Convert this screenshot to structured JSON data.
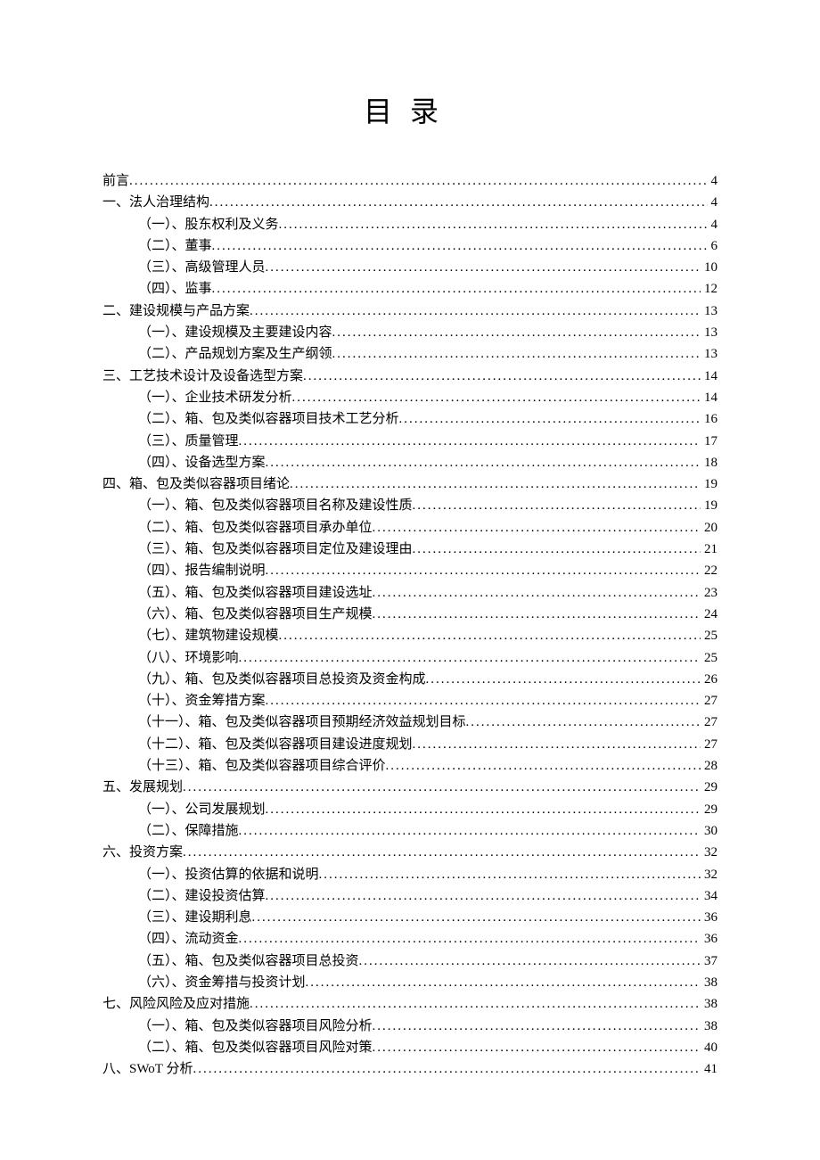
{
  "title": "目录",
  "toc": [
    {
      "label": "前言",
      "page": "4",
      "level": 0
    },
    {
      "label": "一、法人治理结构",
      "page": "4",
      "level": 0
    },
    {
      "label": "（一）、股东权利及义务",
      "page": "4",
      "level": 1
    },
    {
      "label": "（二）、董事",
      "page": "6",
      "level": 1
    },
    {
      "label": "（三）、高级管理人员",
      "page": "10",
      "level": 1
    },
    {
      "label": "（四）、监事",
      "page": "12",
      "level": 1
    },
    {
      "label": "二、建设规模与产品方案",
      "page": "13",
      "level": 0
    },
    {
      "label": "（一）、建设规模及主要建设内容",
      "page": "13",
      "level": 1
    },
    {
      "label": "（二）、产品规划方案及生产纲领",
      "page": "13",
      "level": 1
    },
    {
      "label": "三、工艺技术设计及设备选型方案",
      "page": "14",
      "level": 0
    },
    {
      "label": "（一）、企业技术研发分析",
      "page": "14",
      "level": 1
    },
    {
      "label": "（二）、箱、包及类似容器项目技术工艺分析",
      "page": "16",
      "level": 1
    },
    {
      "label": "（三）、质量管理",
      "page": "17",
      "level": 1
    },
    {
      "label": "（四）、设备选型方案",
      "page": "18",
      "level": 1
    },
    {
      "label": "四、箱、包及类似容器项目绪论",
      "page": "19",
      "level": 0
    },
    {
      "label": "（一）、箱、包及类似容器项目名称及建设性质",
      "page": "19",
      "level": 1
    },
    {
      "label": "（二）、箱、包及类似容器项目承办单位",
      "page": "20",
      "level": 1
    },
    {
      "label": "（三）、箱、包及类似容器项目定位及建设理由",
      "page": "21",
      "level": 1
    },
    {
      "label": "（四）、报告编制说明",
      "page": "22",
      "level": 1
    },
    {
      "label": "（五）、箱、包及类似容器项目建设选址",
      "page": "23",
      "level": 1
    },
    {
      "label": "（六）、箱、包及类似容器项目生产规模",
      "page": "24",
      "level": 1
    },
    {
      "label": "（七）、建筑物建设规模",
      "page": "25",
      "level": 1
    },
    {
      "label": "（八）、环境影响",
      "page": "25",
      "level": 1
    },
    {
      "label": "（九）、箱、包及类似容器项目总投资及资金构成",
      "page": "26",
      "level": 1
    },
    {
      "label": "（十）、资金筹措方案",
      "page": "27",
      "level": 1
    },
    {
      "label": "（十一）、箱、包及类似容器项目预期经济效益规划目标",
      "page": "27",
      "level": 1
    },
    {
      "label": "（十二）、箱、包及类似容器项目建设进度规划",
      "page": "27",
      "level": 1
    },
    {
      "label": "（十三）、箱、包及类似容器项目综合评价",
      "page": "28",
      "level": 1
    },
    {
      "label": "五、发展规划",
      "page": "29",
      "level": 0
    },
    {
      "label": "（一）、公司发展规划",
      "page": "29",
      "level": 1
    },
    {
      "label": "（二）、保障措施",
      "page": "30",
      "level": 1
    },
    {
      "label": "六、投资方案",
      "page": "32",
      "level": 0
    },
    {
      "label": "（一）、投资估算的依据和说明",
      "page": "32",
      "level": 1
    },
    {
      "label": "（二）、建设投资估算",
      "page": "34",
      "level": 1
    },
    {
      "label": "（三）、建设期利息",
      "page": "36",
      "level": 1
    },
    {
      "label": "（四）、流动资金",
      "page": "36",
      "level": 1
    },
    {
      "label": "（五）、箱、包及类似容器项目总投资",
      "page": "37",
      "level": 1
    },
    {
      "label": "（六）、资金筹措与投资计划",
      "page": "38",
      "level": 1
    },
    {
      "label": "七、风险风险及应对措施",
      "page": "38",
      "level": 0
    },
    {
      "label": "（一）、箱、包及类似容器项目风险分析",
      "page": "38",
      "level": 1
    },
    {
      "label": "（二）、箱、包及类似容器项目风险对策",
      "page": "40",
      "level": 1
    },
    {
      "label": "八、SWoT 分析",
      "page": "41",
      "level": 0
    }
  ]
}
